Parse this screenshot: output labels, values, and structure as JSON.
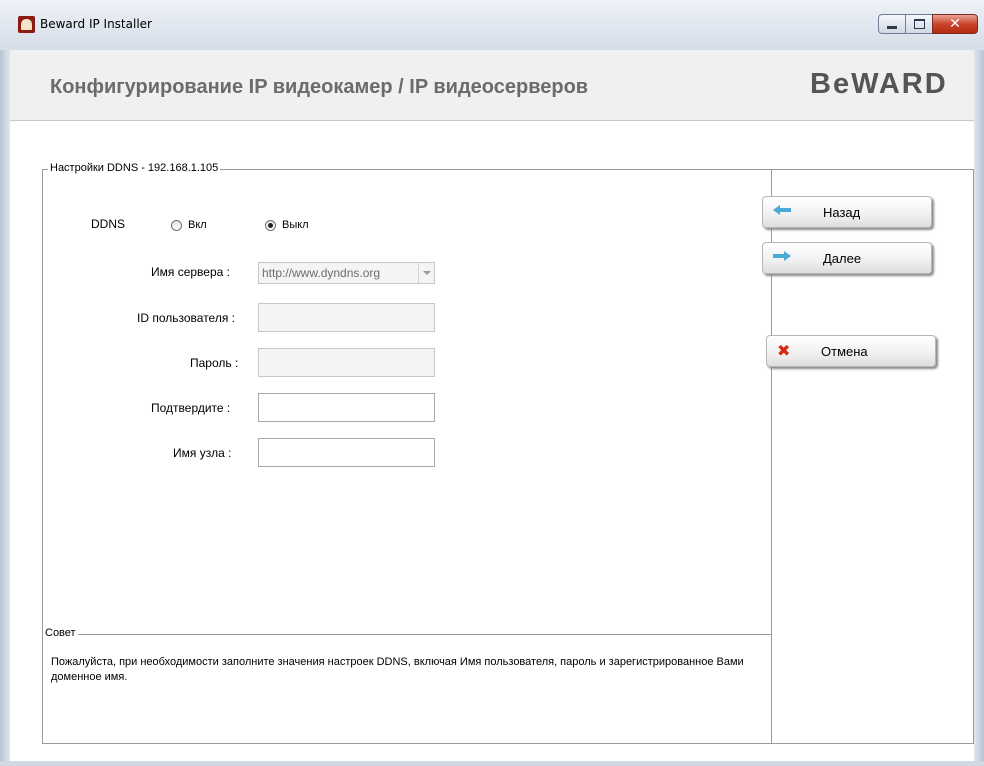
{
  "window": {
    "title": "Beward IP Installer"
  },
  "header": {
    "title": "Конфигурирование IP видеокамер / IP видеосерверов",
    "brand": "BeWARD"
  },
  "ddns_group": {
    "legend": "Настройки DDNS - 192.168.1.105",
    "ddns_label": "DDNS",
    "radio_on_label": "Вкл",
    "radio_off_label": "Выкл",
    "selected": "Выкл",
    "server_label": "Имя сервера :",
    "server_value": "http://www.dyndns.org",
    "user_id_label": "ID пользователя :",
    "user_id_value": "",
    "password_label": "Пароль :",
    "password_value": "",
    "confirm_label": "Подтвердите  :",
    "confirm_value": "",
    "hostname_label": "Имя узла :",
    "hostname_value": ""
  },
  "tip": {
    "legend": "Совет",
    "text": "Пожалуйста, при необходимости заполните значения настроек DDNS, включая Имя пользователя,  пароль и зарегистрированное Вами доменное имя."
  },
  "buttons": {
    "back_label": "Назад",
    "next_label": "Далее",
    "cancel_label": "Отмена"
  },
  "icons": {
    "back": "arrow-left-icon",
    "next": "arrow-right-icon",
    "cancel": "red-x-icon",
    "app": "beward-app-icon"
  },
  "colors": {
    "arrow": "#4aa9d6",
    "cancel": "#d62a10",
    "header_text": "#6b6b6b"
  }
}
